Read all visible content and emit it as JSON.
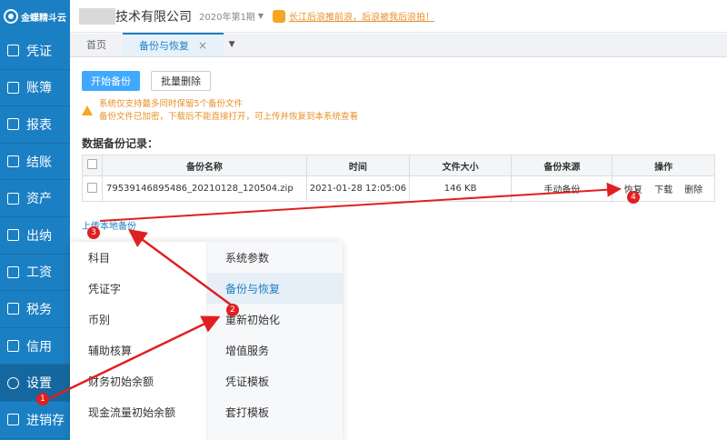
{
  "brand": {
    "name": "金蝶精斗云"
  },
  "header": {
    "company": "技术有限公司",
    "period": "2020年第1期",
    "notice": "长江后浪推前浪，后浪被我后浪拍！"
  },
  "sidebar": {
    "items": [
      {
        "label": "凭证",
        "icon": "voucher-icon"
      },
      {
        "label": "账簿",
        "icon": "ledger-icon"
      },
      {
        "label": "报表",
        "icon": "report-icon"
      },
      {
        "label": "结账",
        "icon": "close-books-icon"
      },
      {
        "label": "资产",
        "icon": "asset-icon"
      },
      {
        "label": "出纳",
        "icon": "cashier-icon"
      },
      {
        "label": "工资",
        "icon": "salary-icon"
      },
      {
        "label": "税务",
        "icon": "tax-icon"
      },
      {
        "label": "信用",
        "icon": "credit-icon"
      },
      {
        "label": "设置",
        "icon": "gear-icon"
      },
      {
        "label": "进销存",
        "icon": "inventory-icon"
      }
    ]
  },
  "tabs": {
    "home": "首页",
    "backup": "备份与恢复"
  },
  "toolbar": {
    "start_backup": "开始备份",
    "batch_delete": "批量删除"
  },
  "warning": {
    "line1": "系统仅支持最多同时保留5个备份文件",
    "line2": "备份文件已加密，下载后不能直接打开，可上传并恢复到本系统查看"
  },
  "records": {
    "title": "数据备份记录：",
    "columns": {
      "name": "备份名称",
      "time": "时间",
      "size": "文件大小",
      "source": "备份来源",
      "ops": "操作"
    },
    "rows": [
      {
        "name": "79539146895486_20210128_120504.zip",
        "time": "2021-01-28 12:05:06",
        "size": "146 KB",
        "source": "手动备份",
        "restore": "恢复",
        "download": "下载",
        "delete": "删除"
      }
    ]
  },
  "upload": {
    "label": "上传本地备份"
  },
  "settings_menu": {
    "left": [
      "科目",
      "凭证字",
      "币别",
      "辅助核算",
      "财务初始余额",
      "现金流量初始余额"
    ],
    "right": [
      "系统参数",
      "备份与恢复",
      "重新初始化",
      "增值服务",
      "凭证模板",
      "套打模板"
    ]
  },
  "annotations": {
    "n1": "1",
    "n2": "2",
    "n3": "3",
    "n4": "4"
  },
  "colors": {
    "sidebar": "#1b7fc3",
    "primary": "#40a9ff",
    "warning": "#e8902a",
    "annotation": "#e02020"
  }
}
